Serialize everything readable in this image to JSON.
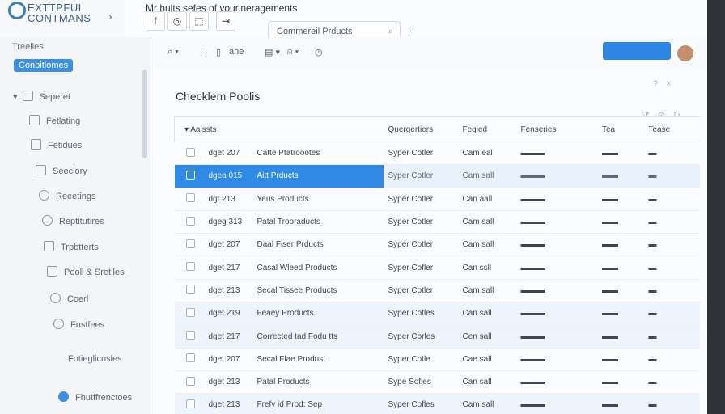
{
  "brand": {
    "line1": "EXTTPFUL",
    "line2": "CONTMANS"
  },
  "header": {
    "title": "Mr hults sefes of your.neragements",
    "search_placeholder": "Commereil Prducts",
    "icons": [
      "f",
      "◎",
      "⬚",
      "⇥"
    ]
  },
  "sidebar": {
    "section_label": "Treelles",
    "active_pill": "Conbitlomes",
    "items": [
      {
        "label": "Seperet",
        "icon": "grid-icon"
      },
      {
        "label": "Fetlating",
        "icon": "list-icon"
      },
      {
        "label": "Fetidues",
        "icon": "tag-icon"
      },
      {
        "label": "Seeclory",
        "icon": "box-icon"
      },
      {
        "label": "Reeetings",
        "icon": "gear-icon"
      },
      {
        "label": "Reptitutires",
        "icon": "cycle-icon"
      },
      {
        "label": "Trpbtterts",
        "icon": "doc-icon"
      },
      {
        "label": "Pooll & Sretlles",
        "icon": "folder-icon"
      },
      {
        "label": "Coerl",
        "icon": "circle-icon"
      },
      {
        "label": "Fnstfees",
        "icon": "star-icon"
      },
      {
        "label": "Fotieglicnsles",
        "icon": "link-icon"
      },
      {
        "label": "Fhutffrenctoes",
        "icon": "user-icon"
      }
    ]
  },
  "toolbar": {
    "items": [
      "⌕ ▾",
      "⋮",
      "▯",
      "ane",
      "▤ ▾",
      "⍝ ▾",
      "◷"
    ]
  },
  "main": {
    "title": "Checklem Poolis",
    "columns": [
      "Aalssts",
      "Quergertiers",
      "Fegied",
      "Fenseries",
      "Tea",
      "Tease"
    ],
    "rows": [
      {
        "code": "dget 207",
        "name": "Catte Ptatroootes",
        "category": "Syper Cotler",
        "status": "Cam eal"
      },
      {
        "code": "dgea 015",
        "name": "Aitt Prducts",
        "category": "Syper Cotler",
        "status": "Cam sall"
      },
      {
        "code": "dgt 213",
        "name": "Yeus Products",
        "category": "Syper Cotler",
        "status": "Can aall"
      },
      {
        "code": "dgeg 313",
        "name": "Patal Tropraducts",
        "category": "Syper Cotler",
        "status": "Cam sall"
      },
      {
        "code": "dget 207",
        "name": "Daal Fiser Prducts",
        "category": "Syper Cotler",
        "status": "Cam sall"
      },
      {
        "code": "dget 217",
        "name": "Casal Wleed Products",
        "category": "Syper Cofler",
        "status": "Can ssll"
      },
      {
        "code": "dget 213",
        "name": "Secal Tissee Products",
        "category": "Syper Cotler",
        "status": "Cam sall"
      },
      {
        "code": "dget 219",
        "name": "Feaey Products",
        "category": "Syper Cotles",
        "status": "Can sall"
      },
      {
        "code": "dget 217",
        "name": "Corrected tad Fodu tts",
        "category": "Syper Corles",
        "status": "Cen sall"
      },
      {
        "code": "dget 207",
        "name": "Secal Flae Produst",
        "category": "Syper Cotle",
        "status": "Cae sall"
      },
      {
        "code": "dget 213",
        "name": "Patal Products",
        "category": "Sype Sofles",
        "status": "Can sall"
      },
      {
        "code": "dget 213",
        "name": "Frefy id Prod: Sep",
        "category": "Syper Cofles",
        "status": "Cam sall"
      }
    ]
  }
}
